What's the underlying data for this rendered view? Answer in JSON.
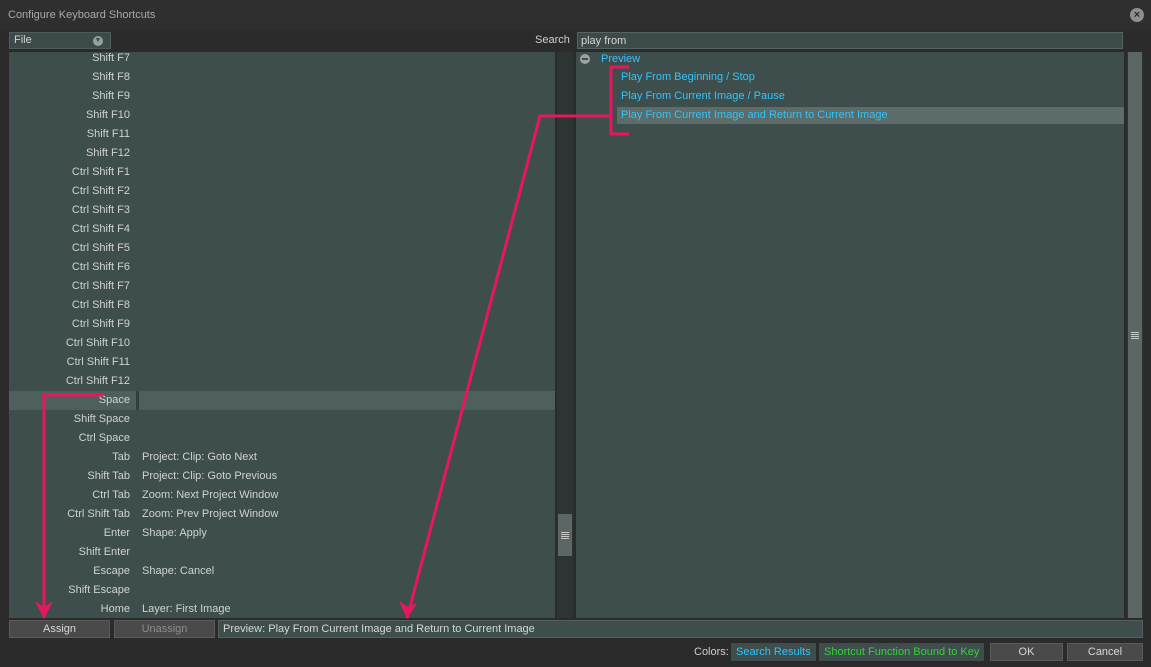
{
  "window": {
    "title": "Configure Keyboard Shortcuts",
    "close_glyph": "×"
  },
  "toolbar": {
    "category_selected": "File",
    "search_label": "Search",
    "search_value": "play from"
  },
  "keys": [
    {
      "key": "Shift F7",
      "function": ""
    },
    {
      "key": "Shift F8",
      "function": ""
    },
    {
      "key": "Shift F9",
      "function": ""
    },
    {
      "key": "Shift F10",
      "function": ""
    },
    {
      "key": "Shift F11",
      "function": ""
    },
    {
      "key": "Shift F12",
      "function": ""
    },
    {
      "key": "Ctrl Shift F1",
      "function": ""
    },
    {
      "key": "Ctrl Shift F2",
      "function": ""
    },
    {
      "key": "Ctrl Shift F3",
      "function": ""
    },
    {
      "key": "Ctrl Shift F4",
      "function": ""
    },
    {
      "key": "Ctrl Shift F5",
      "function": ""
    },
    {
      "key": "Ctrl Shift F6",
      "function": ""
    },
    {
      "key": "Ctrl Shift F7",
      "function": ""
    },
    {
      "key": "Ctrl Shift F8",
      "function": ""
    },
    {
      "key": "Ctrl Shift F9",
      "function": ""
    },
    {
      "key": "Ctrl Shift F10",
      "function": ""
    },
    {
      "key": "Ctrl Shift F11",
      "function": ""
    },
    {
      "key": "Ctrl Shift F12",
      "function": ""
    },
    {
      "key": "Space",
      "function": "",
      "selected": true
    },
    {
      "key": "Shift Space",
      "function": ""
    },
    {
      "key": "Ctrl Space",
      "function": ""
    },
    {
      "key": "Tab",
      "function": "Project: Clip: Goto Next"
    },
    {
      "key": "Shift Tab",
      "function": "Project: Clip: Goto Previous"
    },
    {
      "key": "Ctrl Tab",
      "function": "Zoom: Next Project Window"
    },
    {
      "key": "Ctrl Shift Tab",
      "function": "Zoom: Prev Project Window"
    },
    {
      "key": "Enter",
      "function": "Shape: Apply"
    },
    {
      "key": "Shift Enter",
      "function": ""
    },
    {
      "key": "Escape",
      "function": "Shape: Cancel"
    },
    {
      "key": "Shift Escape",
      "function": ""
    },
    {
      "key": "Home",
      "function": "Layer: First Image"
    }
  ],
  "results": {
    "group": "Preview",
    "items": [
      {
        "label": "Play From Beginning / Stop"
      },
      {
        "label": "Play From Current Image / Pause"
      },
      {
        "label": "Play From Current Image and Return to Current Image",
        "selected": true
      }
    ]
  },
  "footer": {
    "assign_label": "Assign",
    "unassign_label": "Unassign",
    "binding_text": "Preview: Play From Current Image and Return to Current Image",
    "colors_label": "Colors:",
    "legend_search": "Search Results",
    "legend_bound": "Shortcut Function Bound to Key",
    "ok_label": "OK",
    "cancel_label": "Cancel"
  },
  "colors": {
    "search_result": "#2ec5ff",
    "bound_function": "#35d23a",
    "annotation": "#e8175d",
    "panel_bg": "#3e4e4c"
  },
  "icons": {
    "close": "close-icon",
    "dropdown": "chevron-down-icon",
    "tree_toggle": "collapse-icon",
    "scroll_grip": "grip-icon"
  }
}
